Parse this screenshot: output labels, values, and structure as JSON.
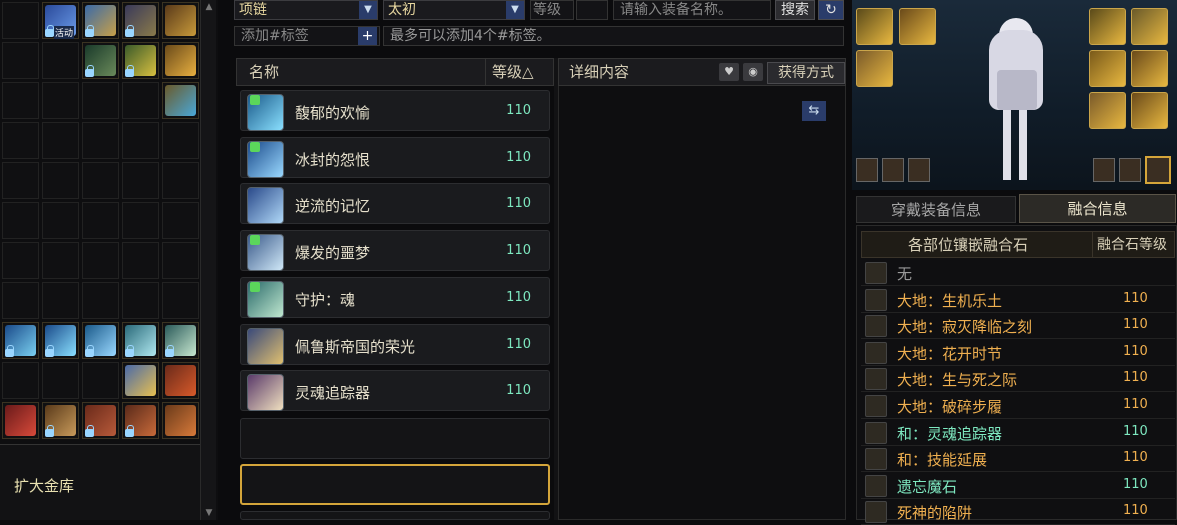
{
  "search": {
    "slot_type": "项链",
    "grade": "太初",
    "level_label": "等级",
    "name_placeholder": "请输入装备名称。",
    "search_button": "搜索",
    "tag_placeholder": "添加#标签",
    "tag_hint": "最多可以添加4个#标签。"
  },
  "list": {
    "col_name": "名称",
    "col_level": "等级△",
    "items": [
      {
        "name": "馥郁的欢愉",
        "level": "110"
      },
      {
        "name": "冰封的怨恨",
        "level": "110"
      },
      {
        "name": "逆流的记忆",
        "level": "110"
      },
      {
        "name": "爆发的噩梦",
        "level": "110"
      },
      {
        "name": "守护：魂",
        "level": "110"
      },
      {
        "name": "佩鲁斯帝国的荣光",
        "level": "110"
      },
      {
        "name": "灵魂追踪器",
        "level": "110"
      }
    ]
  },
  "detail": {
    "title": "详细内容",
    "acquire_button": "获得方式"
  },
  "inventory": {
    "expand_label": "扩大金库",
    "badge_text": "活动"
  },
  "right": {
    "tab_equip": "穿戴装备信息",
    "tab_fusion": "融合信息",
    "col_part": "各部位镶嵌融合石",
    "col_level": "融合石等级",
    "rows": [
      {
        "name": "无",
        "level": "",
        "color": "#9a9a9a"
      },
      {
        "name": "大地：生机乐土",
        "level": "110",
        "color": "#f0b050"
      },
      {
        "name": "大地：寂灭降临之刻",
        "level": "110",
        "color": "#f0b050"
      },
      {
        "name": "大地：花开时节",
        "level": "110",
        "color": "#f0b050"
      },
      {
        "name": "大地：生与死之际",
        "level": "110",
        "color": "#f0b050"
      },
      {
        "name": "大地：破碎步履",
        "level": "110",
        "color": "#f0b050"
      },
      {
        "name": "和：灵魂追踪器",
        "level": "110",
        "color": "#7ee8c0"
      },
      {
        "name": "和：技能延展",
        "level": "110",
        "color": "#f0b050"
      },
      {
        "name": "遗忘魔石",
        "level": "110",
        "color": "#7ee8c0"
      },
      {
        "name": "死神的陷阱",
        "level": "110",
        "color": "#f0b050"
      }
    ]
  },
  "colors": {
    "accent_gold": "#d4a53a",
    "level_teal": "#7ee8c0",
    "fusion_orange": "#f0b050"
  }
}
